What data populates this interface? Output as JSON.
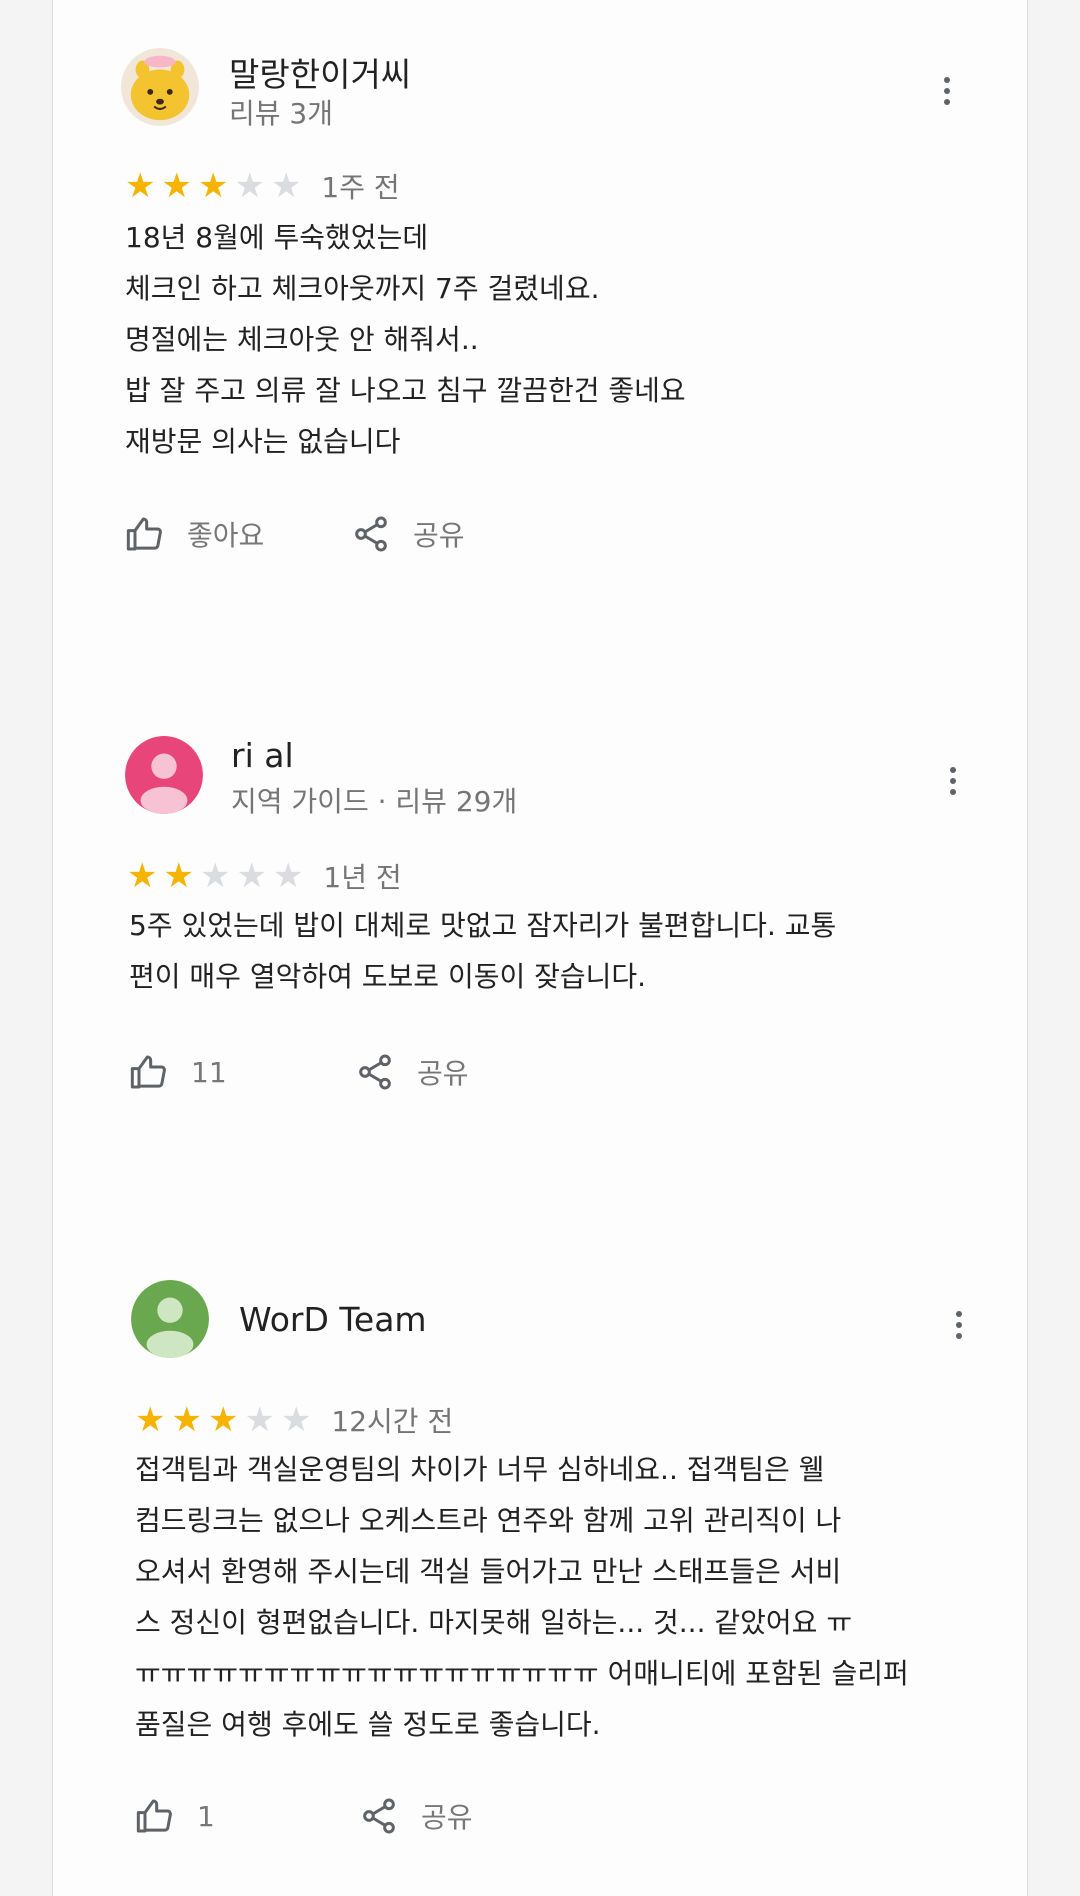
{
  "reviews": [
    {
      "author": "말랑한이거씨",
      "meta": "리뷰 3개",
      "rating": 3,
      "time": "1주 전",
      "lines": [
        "18년 8월에 투숙했었는데",
        "체크인 하고 체크아웃까지 7주 걸렸네요.",
        "명절에는 체크아웃 안 해줘서..",
        "밥 잘 주고 의류 잘 나오고 침구 깔끔한건 좋네요",
        "재방문 의사는 없습니다"
      ],
      "like_label": "좋아요",
      "share_label": "공유",
      "avatar_icon": "yellow-character-icon"
    },
    {
      "author": "ri al",
      "meta": "지역 가이드 · 리뷰 29개",
      "rating": 2,
      "time": "1년 전",
      "lines": [
        "5주 있었는데 밥이 대체로 맛없고 잠자리가 불편합니다. 교통",
        "편이 매우 열악하여 도보로 이동이 잦습니다."
      ],
      "like_label": "11",
      "share_label": "공유",
      "avatar_icon": "person-icon",
      "avatar_color": "#e8457a"
    },
    {
      "author": "WorD Team",
      "meta": "",
      "rating": 3,
      "time": "12시간 전",
      "lines": [
        "접객팀과 객실운영팀의 차이가 너무 심하네요.. 접객팀은 웰",
        "컴드링크는 없으나 오케스트라 연주와 함께 고위 관리직이 나",
        "오셔서 환영해 주시는데 객실 들어가고 만난 스태프들은 서비",
        "스 정신이 형편없습니다. 마지못해 일하는... 것... 같았어요 ㅠ",
        "ㅠㅠㅠㅠㅠㅠㅠㅠㅠㅠㅠㅠㅠㅠㅠㅠㅠㅠ 어매니티에 포함된 슬리퍼",
        "품질은 여행 후에도 쓸 정도로 좋습니다."
      ],
      "like_label": "1",
      "share_label": "공유",
      "avatar_icon": "person-icon",
      "avatar_color": "#6aa84f"
    }
  ],
  "colors": {
    "star_filled": "#f6b400",
    "star_empty": "#dadce0"
  }
}
